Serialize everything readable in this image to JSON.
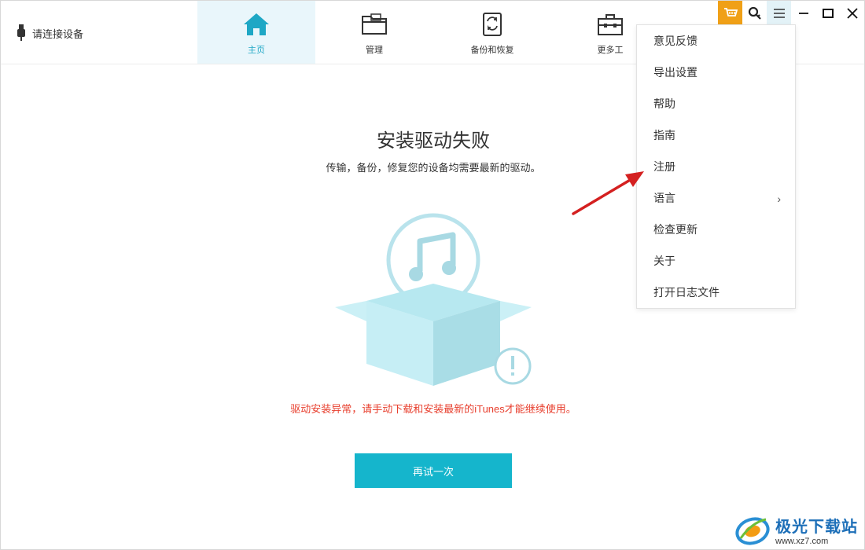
{
  "header": {
    "device_status": "请连接设备",
    "tabs": [
      {
        "label": "主页",
        "icon": "home-icon",
        "active": true
      },
      {
        "label": "管理",
        "icon": "folder-icon",
        "active": false
      },
      {
        "label": "备份和恢复",
        "icon": "backup-restore-icon",
        "active": false
      },
      {
        "label": "更多工",
        "icon": "toolbox-icon",
        "active": false
      }
    ],
    "window_controls": [
      "cart-icon",
      "key-icon",
      "menu-icon",
      "minimize-icon",
      "maximize-icon",
      "close-icon"
    ]
  },
  "main": {
    "title": "安装驱动失败",
    "subtitle": "传输，备份，修复您的设备均需要最新的驱动。",
    "error": "驱动安装异常，请手动下载和安装最新的iTunes才能继续使用。",
    "retry_label": "再试一次"
  },
  "menu": {
    "items": [
      "意见反馈",
      "导出设置",
      "帮助",
      "指南",
      "注册",
      "语言",
      "检查更新",
      "关于",
      "打开日志文件"
    ],
    "submenu_chevron": "›"
  },
  "watermark": {
    "title": "极光下载站",
    "url": "www.xz7.com"
  },
  "colors": {
    "accent": "#15b5cc",
    "active_tab_bg": "#e9f6fb",
    "cart": "#f0a017",
    "error": "#e8402f",
    "arrow": "#d42020"
  }
}
